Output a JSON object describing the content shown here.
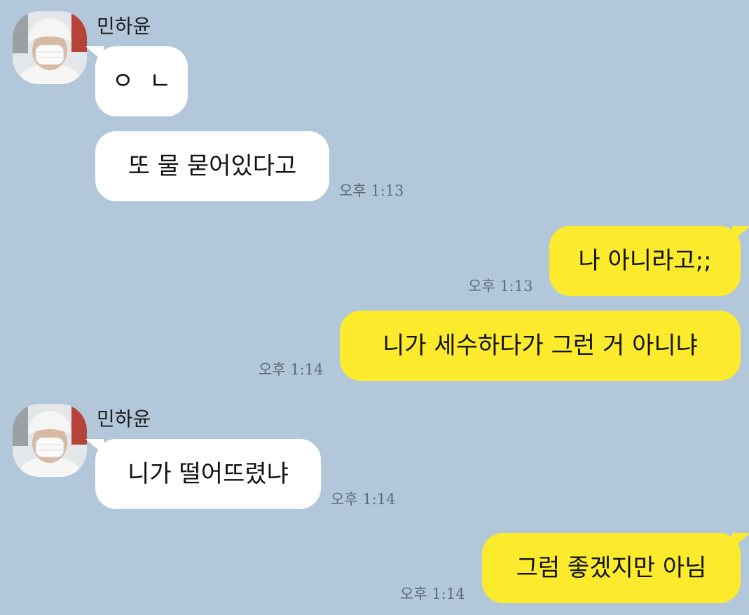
{
  "chat": {
    "colors": {
      "background": "#b2c7da",
      "incoming_bubble": "#ffffff",
      "outgoing_bubble": "#fbeb2c",
      "timestamp": "#5d6b78"
    },
    "messages": [
      {
        "sender": "민하윤",
        "direction": "incoming",
        "text": "ㅇㄴ",
        "time": ""
      },
      {
        "sender": "민하윤",
        "direction": "incoming",
        "text": "또 물 묻어있다고",
        "time": "오후 1:13"
      },
      {
        "sender": "me",
        "direction": "outgoing",
        "text": "나 아니라고;;",
        "time": "오후 1:13"
      },
      {
        "sender": "me",
        "direction": "outgoing",
        "text": "니가 세수하다가 그런 거 아니냐",
        "time": "오후 1:14"
      },
      {
        "sender": "민하윤",
        "direction": "incoming",
        "text": "니가 떨어뜨렸냐",
        "time": "오후 1:14"
      },
      {
        "sender": "me",
        "direction": "outgoing",
        "text": "그럼 좋겠지만 아님",
        "time": "오후 1:14"
      }
    ],
    "groups": [
      {
        "sender_name": "민하윤",
        "avatar_icon": "profile-photo-avatar-icon"
      },
      {
        "sender_name": "민하윤",
        "avatar_icon": "profile-photo-avatar-icon"
      }
    ]
  }
}
